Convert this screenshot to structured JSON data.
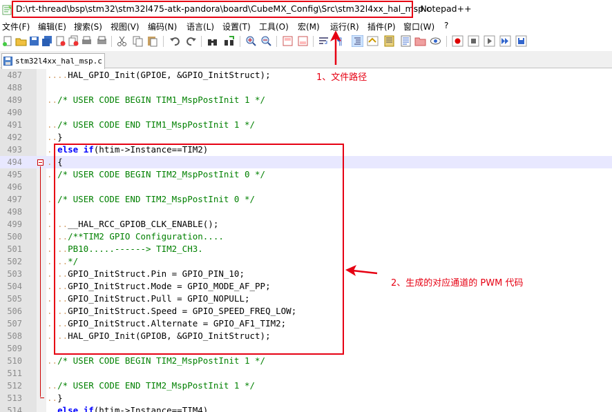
{
  "window": {
    "file_path": "D:\\rt-thread\\bsp\\stm32\\stm32l475-atk-pandora\\board\\CubeMX_Config\\Src\\stm32l4xx_hal_msp.c",
    "app_suffix": "- Notepad++"
  },
  "menu": [
    {
      "label": "文件(F)"
    },
    {
      "label": "编辑(E)"
    },
    {
      "label": "搜索(S)"
    },
    {
      "label": "视图(V)"
    },
    {
      "label": "编码(N)"
    },
    {
      "label": "语言(L)"
    },
    {
      "label": "设置(T)"
    },
    {
      "label": "工具(O)"
    },
    {
      "label": "宏(M)"
    },
    {
      "label": "运行(R)"
    },
    {
      "label": "插件(P)"
    },
    {
      "label": "窗口(W)"
    },
    {
      "label": "?"
    }
  ],
  "toolbar": [
    "new-file-icon",
    "open-file-icon",
    "save-icon",
    "save-all-icon",
    "close-icon",
    "close-all-icon",
    "print-icon",
    "cut-icon",
    "copy-icon",
    "paste-icon",
    "undo-icon",
    "redo-icon",
    "find-icon",
    "replace-icon",
    "zoom-in-icon",
    "zoom-out-icon",
    "sync-v-icon",
    "sync-h-icon",
    "wrap-icon",
    "show-all-chars-icon",
    "indent-guide-icon",
    "lang-icon",
    "doc-map-icon",
    "function-list-icon",
    "folder-icon",
    "monitor-icon",
    "record-macro-icon",
    "stop-macro-icon",
    "play-macro-icon",
    "run-macro-multiple-icon",
    "save-macro-icon"
  ],
  "tab": {
    "label": "stm32l4xx_hal_msp.c"
  },
  "editor": {
    "lines": [
      {
        "n": "487",
        "code": "....HAL_GPIO_Init(GPIOE, &GPIO_InitStruct);"
      },
      {
        "n": "488",
        "code": ""
      },
      {
        "n": "489",
        "code": "../* USER CODE BEGIN TIM1_MspPostInit 1 */"
      },
      {
        "n": "490",
        "code": ""
      },
      {
        "n": "491",
        "code": "../* USER CODE END TIM1_MspPostInit 1 */"
      },
      {
        "n": "492",
        "code": "..}"
      },
      {
        "n": "493",
        "code": "..else if(htim->Instance==TIM2)"
      },
      {
        "n": "494",
        "code": "..{"
      },
      {
        "n": "495",
        "code": "../* USER CODE BEGIN TIM2_MspPostInit 0 */"
      },
      {
        "n": "496",
        "code": ""
      },
      {
        "n": "497",
        "code": "../* USER CODE END TIM2_MspPostInit 0 */"
      },
      {
        "n": "498",
        "code": ".."
      },
      {
        "n": "499",
        "code": "....__HAL_RCC_GPIOB_CLK_ENABLE();"
      },
      {
        "n": "500",
        "code": "..../**TIM2 GPIO Configuration...."
      },
      {
        "n": "501",
        "code": "....PB10.....------> TIM2_CH3."
      },
      {
        "n": "502",
        "code": "....*/"
      },
      {
        "n": "503",
        "code": "....GPIO_InitStruct.Pin = GPIO_PIN_10;"
      },
      {
        "n": "504",
        "code": "....GPIO_InitStruct.Mode = GPIO_MODE_AF_PP;"
      },
      {
        "n": "505",
        "code": "....GPIO_InitStruct.Pull = GPIO_NOPULL;"
      },
      {
        "n": "506",
        "code": "....GPIO_InitStruct.Speed = GPIO_SPEED_FREQ_LOW;"
      },
      {
        "n": "507",
        "code": "....GPIO_InitStruct.Alternate = GPIO_AF1_TIM2;"
      },
      {
        "n": "508",
        "code": "....HAL_GPIO_Init(GPIOB, &GPIO_InitStruct);"
      },
      {
        "n": "509",
        "code": ""
      },
      {
        "n": "510",
        "code": "../* USER CODE BEGIN TIM2_MspPostInit 1 */"
      },
      {
        "n": "511",
        "code": ""
      },
      {
        "n": "512",
        "code": "../* USER CODE END TIM2_MspPostInit 1 */"
      },
      {
        "n": "513",
        "code": "..}"
      },
      {
        "n": "514",
        "code": "..else if(htim->Instance==TIM4)"
      }
    ]
  },
  "annotations": {
    "label1": "1、文件路径",
    "label2": "2、生成的对应通道的 PWM 代码",
    "color": "#e60012"
  }
}
